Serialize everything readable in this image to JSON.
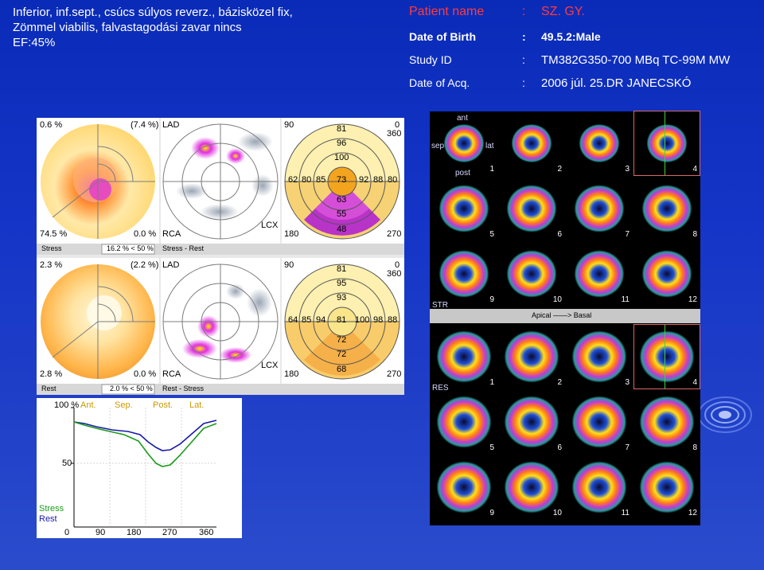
{
  "diagnosis": {
    "line1": "Inferior, inf.sept., csúcs  súlyos reverz., bázisközel fix,",
    "line2": "Zömmel viabilis, falvastagodási zavar nincs",
    "line3": "EF:45%"
  },
  "patient": {
    "name_label": "Patient name",
    "name_colon": ":",
    "name_value": "SZ. GY.",
    "dob_label": "Date of Birth",
    "dob_colon": ":",
    "dob_value": "49.5.2:Male",
    "study_label": "Study ID",
    "study_colon": ":",
    "study_value": "TM382G350-700 MBq TC-99M MW",
    "acq_label": "Date of Acq.",
    "acq_colon": ":",
    "acq_value": "2006 júl. 25.DR JANECSKÓ"
  },
  "stress_panel": {
    "top_left": "0.6 %",
    "top_right": "(7.4 %)",
    "bottom_left": "74.5 %",
    "bottom_right": "0.0 %",
    "lad": "LAD",
    "rca": "RCA",
    "lcx": "LCX",
    "footer_left": "Stress",
    "footer_mid": "16.2 % < 50 %",
    "footer_right": "Stress - Rest",
    "deg_top_left": "90",
    "deg_top_right": "0",
    "deg_top_right2": "360",
    "deg_bottom_left": "180",
    "deg_bottom_right": "270",
    "seg_outer_top": "81",
    "seg_mid_top": "96",
    "seg_inner_top": "100",
    "seg_row": [
      "62",
      "80",
      "85",
      "73",
      "92",
      "88",
      "80"
    ],
    "seg_inner_bottom": "63",
    "seg_mid_bottom": "55",
    "seg_outer_bottom": "48"
  },
  "rest_panel": {
    "top_left": "2.3 %",
    "top_right": "(2.2 %)",
    "bottom_left": "2.8 %",
    "bottom_right": "0.0 %",
    "lad": "LAD",
    "rca": "RCA",
    "lcx": "LCX",
    "footer_left": "Rest",
    "footer_mid": "2.0 % < 50 %",
    "footer_right": "Rest - Stress",
    "deg_top_left": "90",
    "deg_top_right": "0",
    "deg_top_right2": "360",
    "deg_bottom_left": "180",
    "deg_bottom_right": "270",
    "seg_outer_top": "81",
    "seg_mid_top": "95",
    "seg_inner_top": "93",
    "seg_row": [
      "64",
      "85",
      "94",
      "81",
      "100",
      "98",
      "88"
    ],
    "seg_inner_bottom": "72",
    "seg_mid_bottom": "72",
    "seg_outer_bottom": "68"
  },
  "profile_chart": {
    "ylabel_top": "100 %",
    "ylabel_mid": "50",
    "region_labels": [
      "Ant.",
      "Sep.",
      "Post.",
      "Lat."
    ],
    "x_ticks": [
      "0",
      "90",
      "180",
      "270",
      "360"
    ],
    "legend_stress": "Stress",
    "legend_rest": "Rest",
    "stress_color": "#1a9a1a",
    "rest_color": "#1a1aa8"
  },
  "slices": {
    "stress_tag": "STR",
    "rest_tag": "RES",
    "ant": "ant",
    "sep": "sep",
    "lat": "lat",
    "post": "post",
    "stress_numbers": [
      "1",
      "2",
      "3",
      "4",
      "5",
      "6",
      "7",
      "8",
      "9",
      "10",
      "11",
      "12"
    ],
    "rest_numbers": [
      "1",
      "2",
      "3",
      "4",
      "5",
      "6",
      "7",
      "8",
      "9",
      "10",
      "11",
      "12"
    ],
    "separator": "Apical ——> Basal"
  }
}
